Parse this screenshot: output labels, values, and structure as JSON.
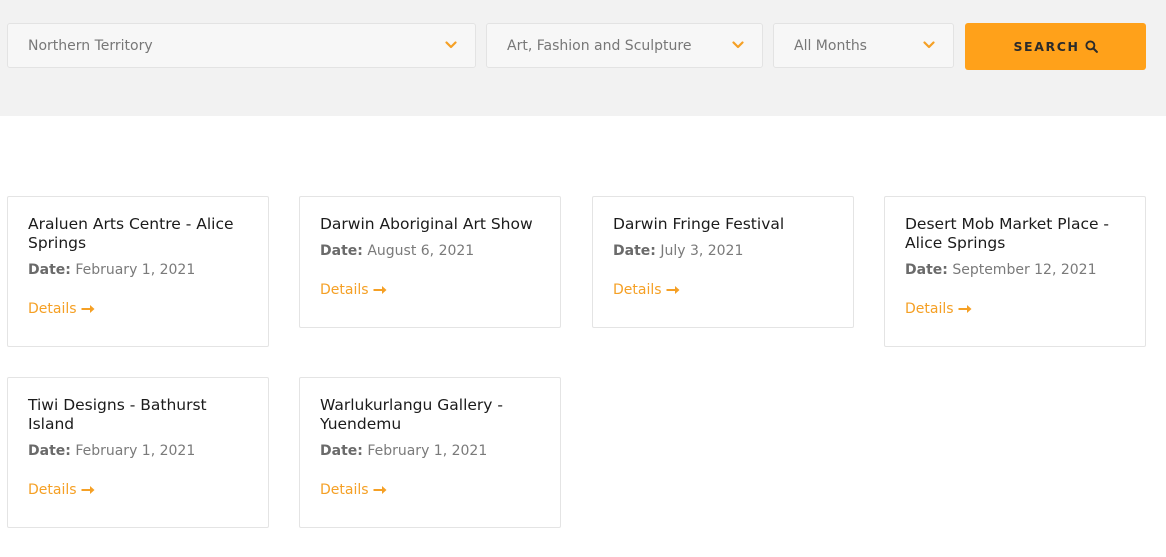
{
  "filters": {
    "region": "Northern Territory",
    "category": "Art, Fashion and Sculpture",
    "month": "All Months",
    "search_label": "SEARCH"
  },
  "events": [
    {
      "title": "Araluen Arts Centre - Alice Springs",
      "date_label": "Date:",
      "date": "February 1, 2021",
      "link_label": "Details"
    },
    {
      "title": "Darwin Aboriginal Art Show",
      "date_label": "Date:",
      "date": "August 6, 2021",
      "link_label": "Details"
    },
    {
      "title": "Darwin Fringe Festival",
      "date_label": "Date:",
      "date": "July 3, 2021",
      "link_label": "Details"
    },
    {
      "title": "Desert Mob Market Place - Alice Springs",
      "date_label": "Date:",
      "date": "September 12, 2021",
      "link_label": "Details"
    },
    {
      "title": "Tiwi Designs - Bathurst Island",
      "date_label": "Date:",
      "date": "February 1, 2021",
      "link_label": "Details"
    },
    {
      "title": "Warlukurlangu Gallery - Yuendemu",
      "date_label": "Date:",
      "date": "February 1, 2021",
      "link_label": "Details"
    }
  ],
  "colors": {
    "accent": "#ffa11a",
    "link": "#f5a025",
    "filter_bar_bg": "#f2f2f2"
  },
  "icons": {
    "dropdown": "chevron-down-icon",
    "search": "search-icon",
    "details": "arrow-right-icon"
  }
}
